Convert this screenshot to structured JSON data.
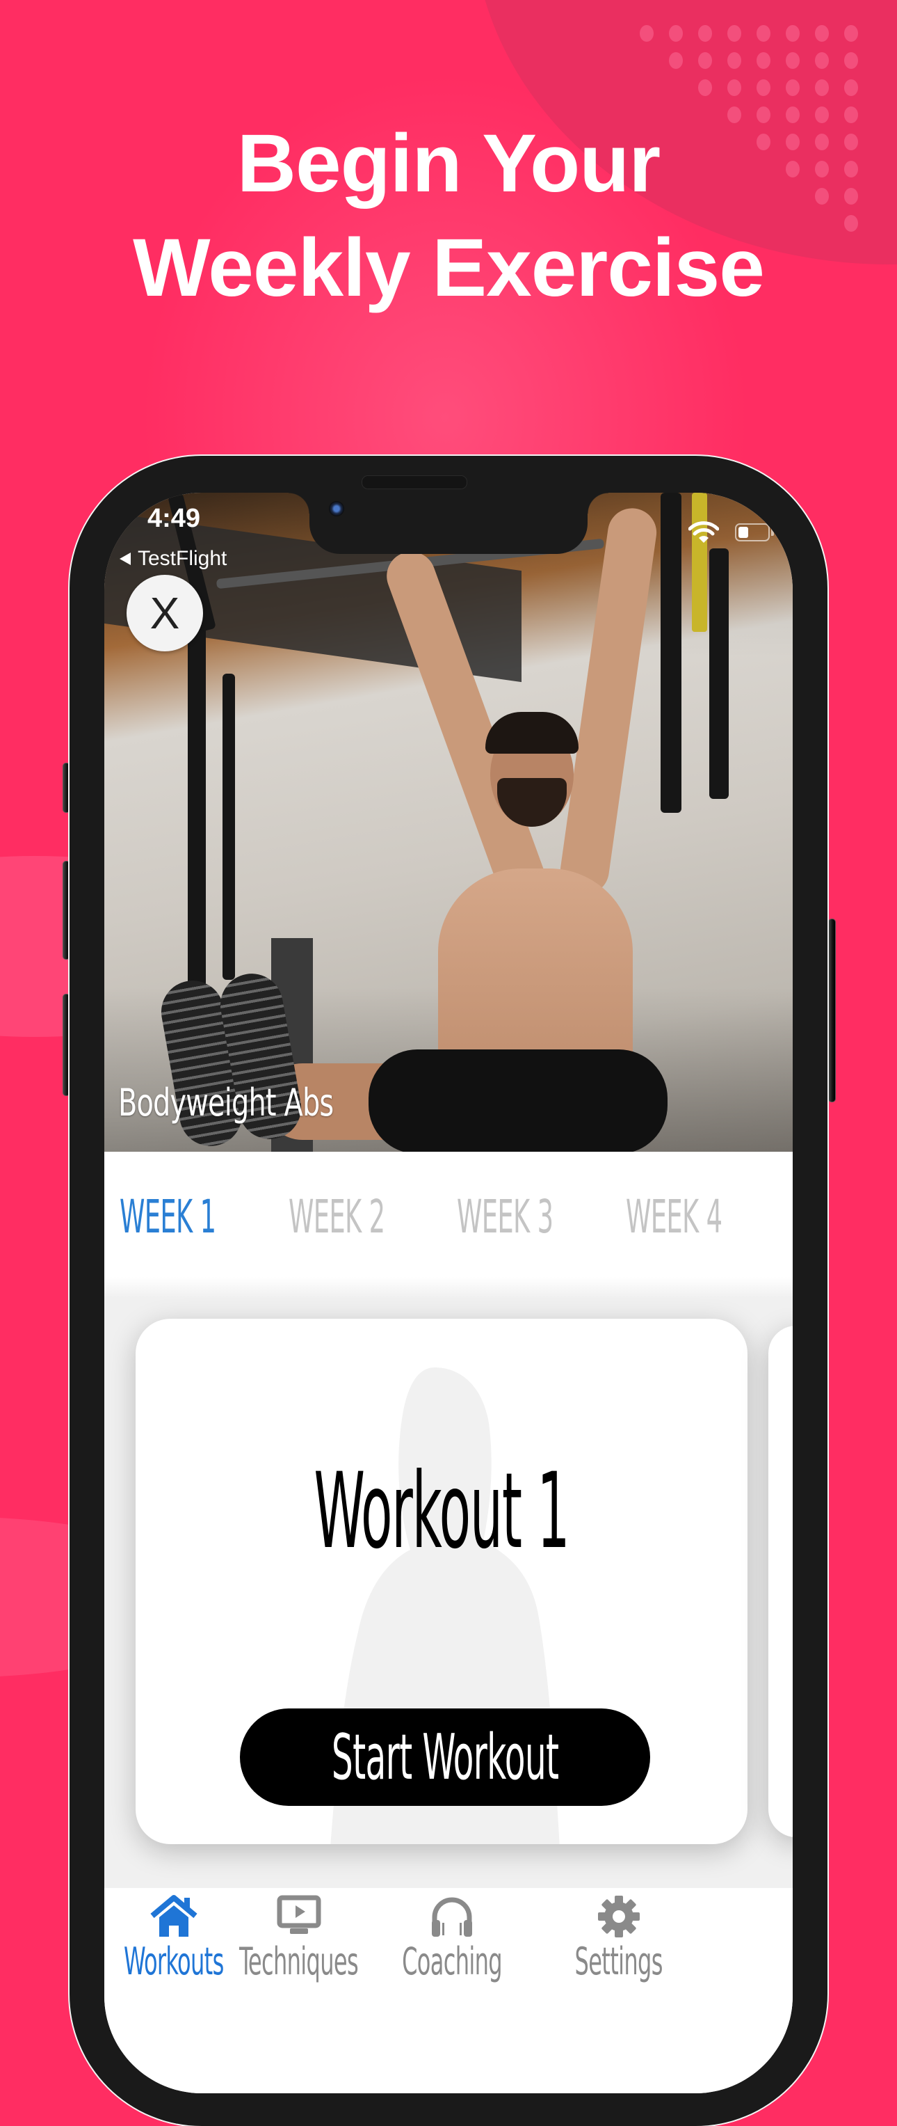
{
  "promo": {
    "headline_line1": "Begin Your",
    "headline_line2": "Weekly Exercise",
    "background_color": "#ff2d62"
  },
  "status_bar": {
    "time": "4:49",
    "back_app": "TestFlight",
    "wifi_icon": "wifi-icon",
    "battery_icon": "battery-low-icon"
  },
  "hero": {
    "close_label": "X",
    "title": "Bodyweight Abs"
  },
  "weeks": {
    "tabs": [
      {
        "label": "WEEK 1",
        "active": true
      },
      {
        "label": "WEEK 2",
        "active": false
      },
      {
        "label": "WEEK 3",
        "active": false
      },
      {
        "label": "WEEK 4",
        "active": false
      }
    ],
    "active_color": "#2a7fd4",
    "inactive_color": "#c4c4c4"
  },
  "workout_card": {
    "title": "Workout 1",
    "button_label": "Start Workout"
  },
  "tab_bar": {
    "items": [
      {
        "label": "Workouts",
        "icon": "home-icon",
        "active": true
      },
      {
        "label": "Techniques",
        "icon": "video-screen-icon",
        "active": false
      },
      {
        "label": "Coaching",
        "icon": "headphones-icon",
        "active": false
      },
      {
        "label": "Settings",
        "icon": "gear-icon",
        "active": false
      }
    ],
    "active_color": "#1f75d6",
    "inactive_color": "#8a8a8a"
  }
}
